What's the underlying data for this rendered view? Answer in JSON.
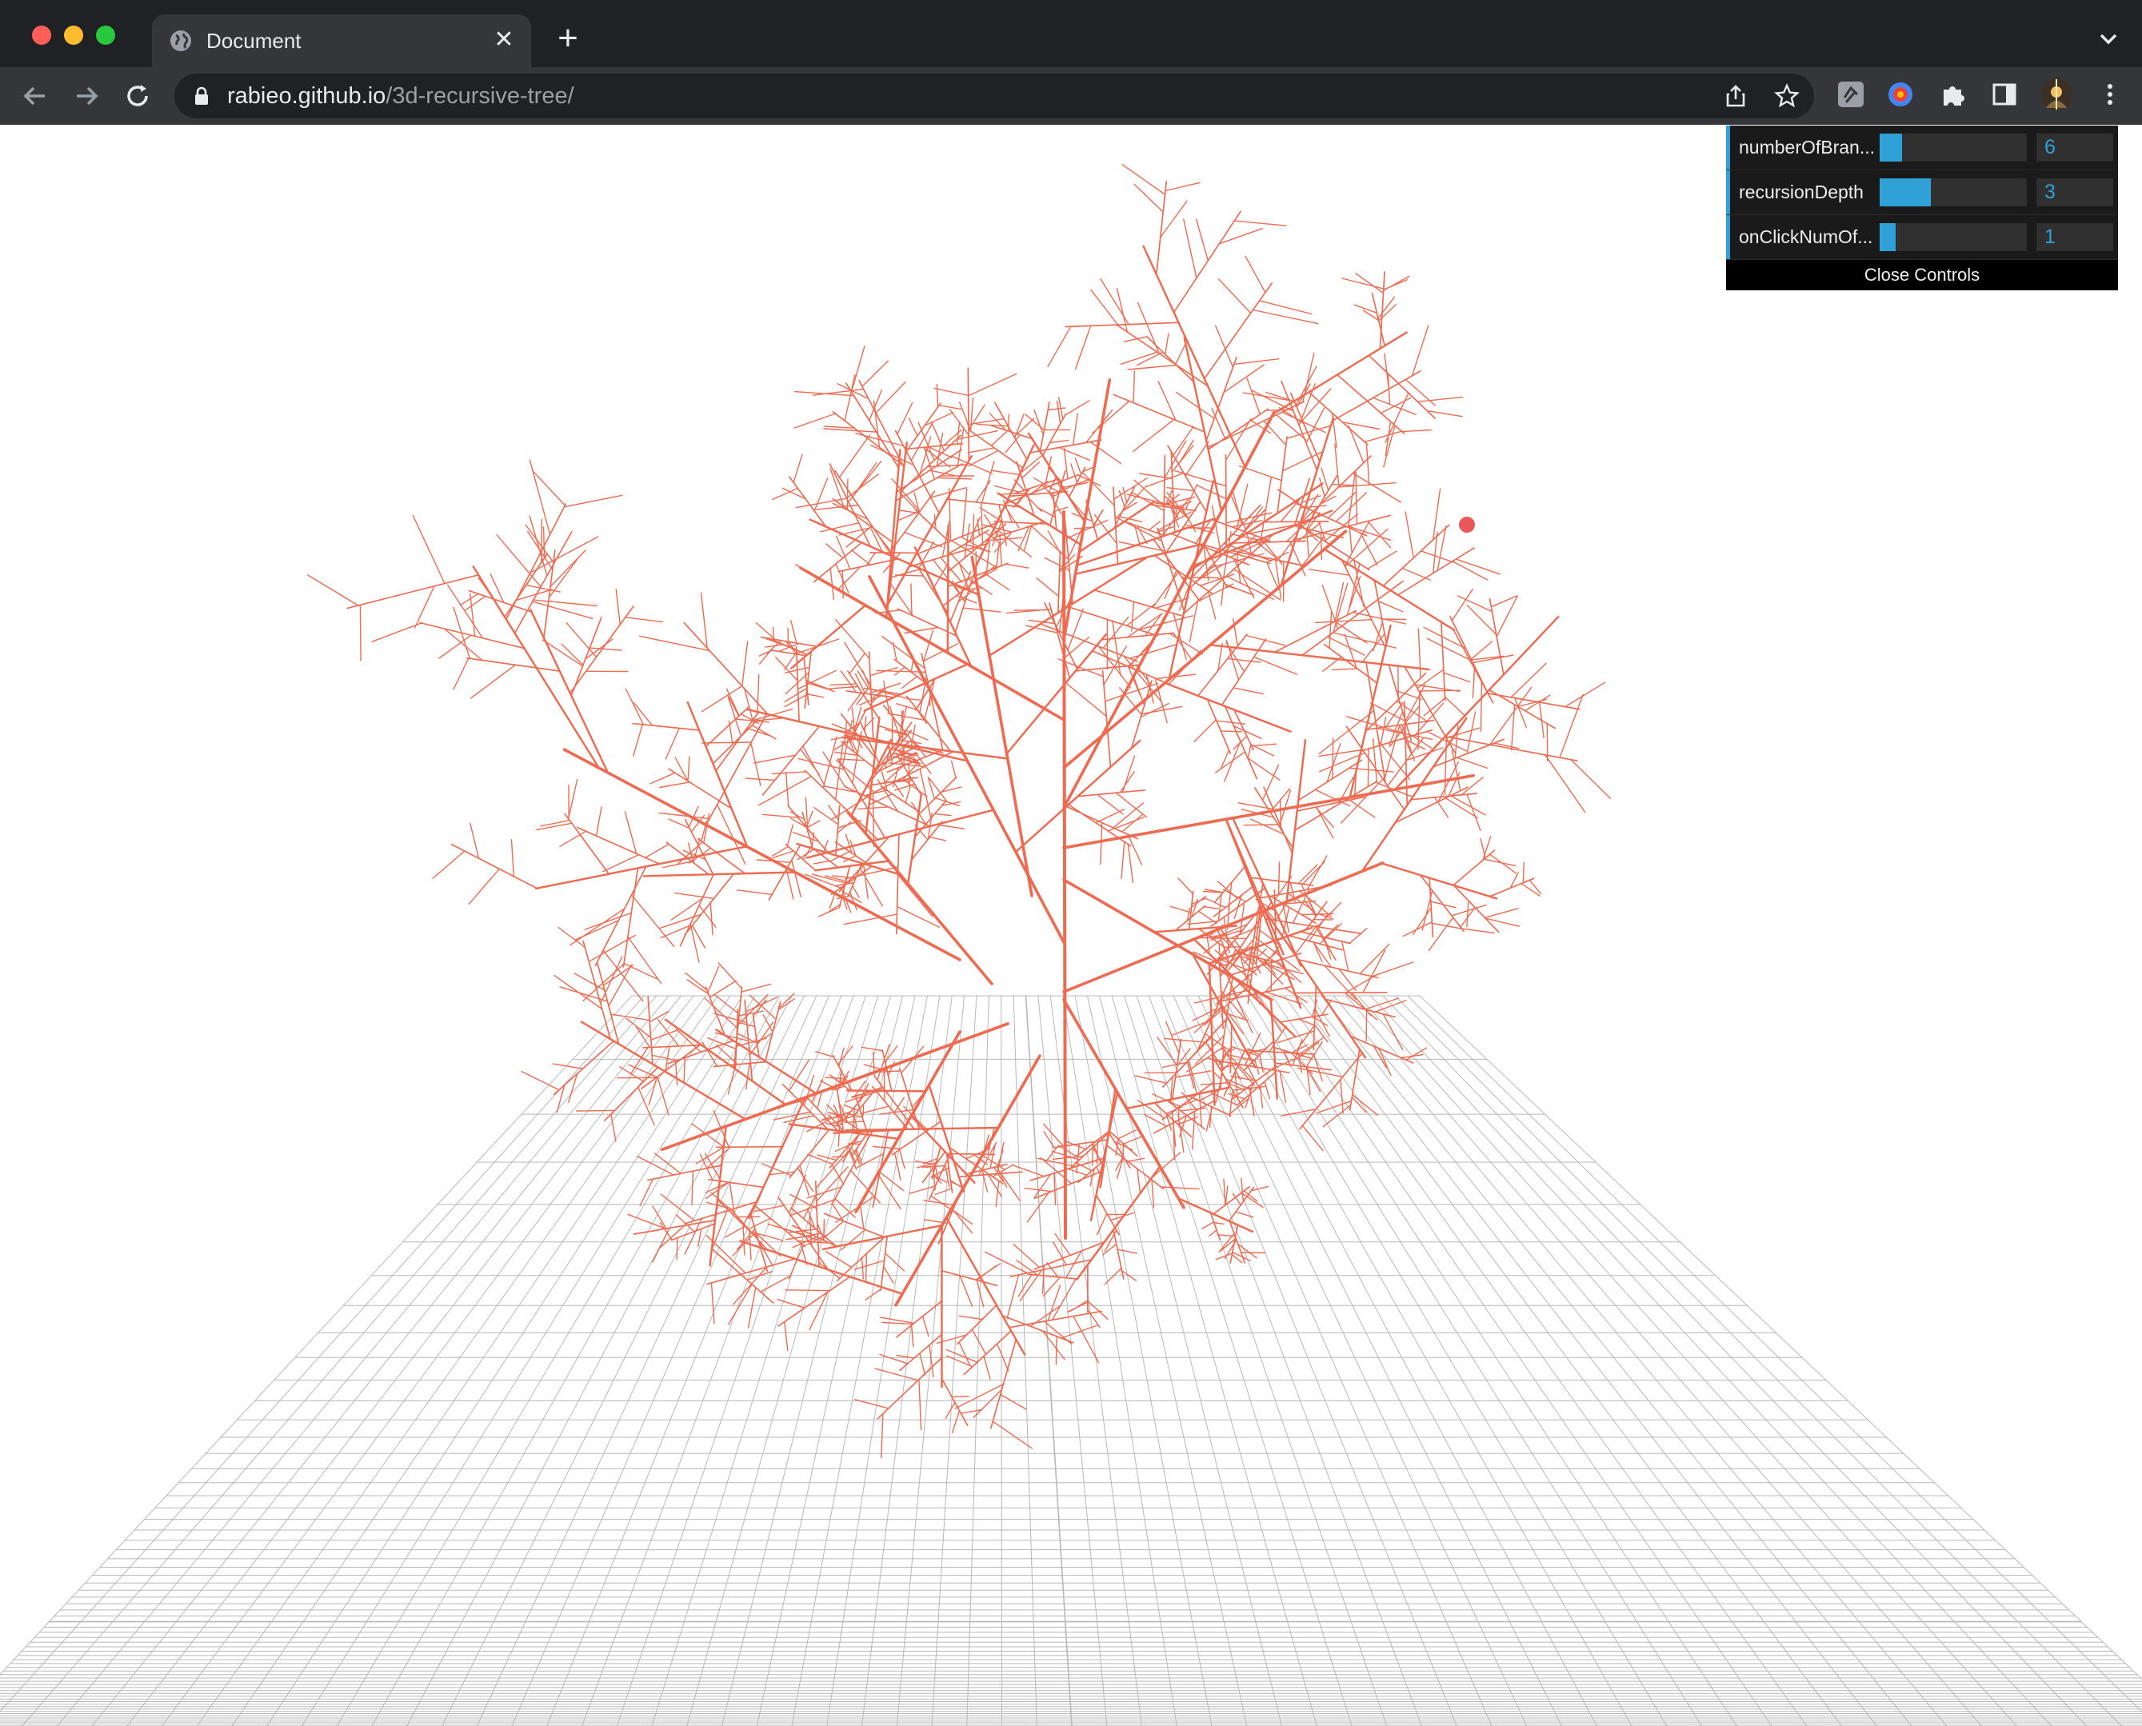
{
  "window": {
    "tab_title": "Document",
    "new_tab_symbol": "+",
    "close_symbol": "✕"
  },
  "address_bar": {
    "url_host": "rabieo.github.io",
    "url_path": "/3d-recursive-tree/"
  },
  "icons": [
    "globe-icon",
    "back-arrow-icon",
    "forward-arrow-icon",
    "reload-icon",
    "lock-icon",
    "share-icon",
    "bookmark-star-icon",
    "extension-icon",
    "puzzle-icon",
    "sidebar-icon",
    "profile-avatar-icon",
    "kebab-menu-icon",
    "tab-list-chevron-icon"
  ],
  "colors": {
    "tree": "#ee6a50",
    "grid": "#b8b8b8",
    "gui_accent": "#2fa1d6",
    "chrome_dark": "#202124"
  },
  "controls": {
    "rows": [
      {
        "label": "numberOfBran...",
        "value": "6",
        "fill_fraction": 0.15
      },
      {
        "label": "recursionDepth",
        "value": "3",
        "fill_fraction": 0.35
      },
      {
        "label": "onClickNumOf...",
        "value": "1",
        "fill_fraction": 0.11
      }
    ],
    "close_label": "Close Controls"
  }
}
